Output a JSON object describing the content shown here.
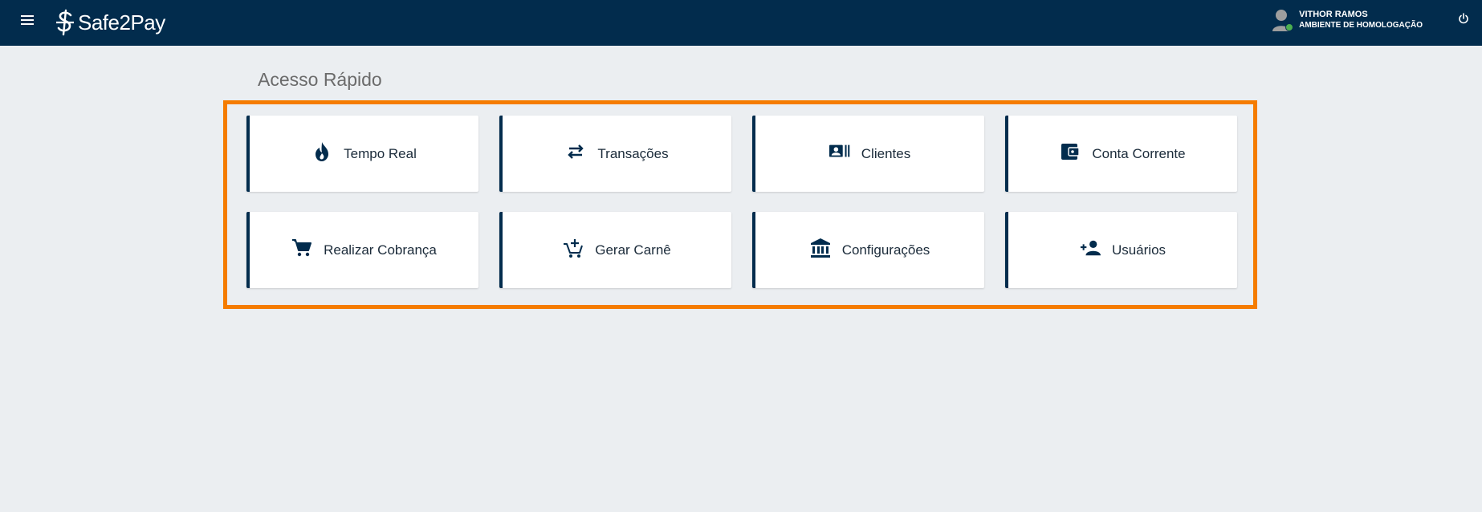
{
  "header": {
    "brand": "Safe2Pay",
    "user_name": "VITHOR RAMOS",
    "user_env": "AMBIENTE DE HOMOLOGAÇÃO"
  },
  "main": {
    "title": "Acesso Rápido",
    "cards": [
      {
        "label": "Tempo Real",
        "icon": "flame-icon"
      },
      {
        "label": "Transações",
        "icon": "swap-arrows-icon"
      },
      {
        "label": "Clientes",
        "icon": "contact-card-icon"
      },
      {
        "label": "Conta Corrente",
        "icon": "wallet-icon"
      },
      {
        "label": "Realizar Cobrança",
        "icon": "cart-icon"
      },
      {
        "label": "Gerar Carnê",
        "icon": "cart-plus-icon"
      },
      {
        "label": "Configurações",
        "icon": "bank-icon"
      },
      {
        "label": "Usuários",
        "icon": "person-add-icon"
      }
    ]
  },
  "colors": {
    "topbar": "#022c4d",
    "background": "#ebeef1",
    "accent_border": "#f57c00",
    "card_accent": "#022c4d",
    "online": "#4caf50"
  }
}
